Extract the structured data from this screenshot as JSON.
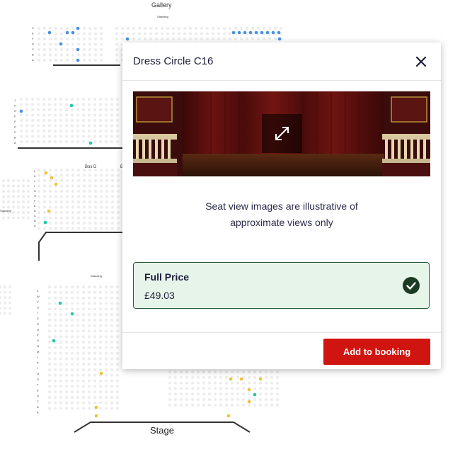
{
  "seat_map": {
    "gallery_label": "Gallery",
    "standing_label": "Standing",
    "box_label": "Box D",
    "box_label_partial": "B",
    "stage_label": "Stage",
    "row_letters_gallery": [
      "C",
      "E",
      "F",
      "D",
      "C",
      "B",
      "A"
    ],
    "row_letters_grand": [
      "J",
      "H",
      "G",
      "F",
      "E",
      "D",
      "C",
      "B",
      "A"
    ],
    "row_letters_dress": [
      "L",
      "K",
      "J",
      "I",
      "H",
      "G",
      "F",
      "E",
      "D",
      "C",
      "B",
      "A"
    ],
    "row_letters_stalls": [
      "Z",
      "W",
      "V",
      "U",
      "T",
      "S",
      "R",
      "Q",
      "P",
      "O",
      "N",
      "M",
      "L",
      "K",
      "J",
      "H",
      "G",
      "F",
      "E",
      "D",
      "C",
      "B",
      "A"
    ],
    "colors": {
      "unavailable": "#ececec",
      "available_blue": "#4a90e2",
      "available_teal": "#1fc9a3",
      "available_yellow": "#f2c233",
      "outline": "#333333"
    }
  },
  "modal": {
    "title": "Dress Circle C16",
    "close_icon": "close-icon",
    "expand_icon": "expand-icon",
    "info_line1": "Seat view images are illustrative of",
    "info_line2": "approximate views only",
    "price": {
      "name": "Full Price",
      "value": "£49.03",
      "selected": true,
      "check_color": "#1d3a24"
    },
    "add_button": "Add to booking",
    "accent": "#d0140f"
  }
}
